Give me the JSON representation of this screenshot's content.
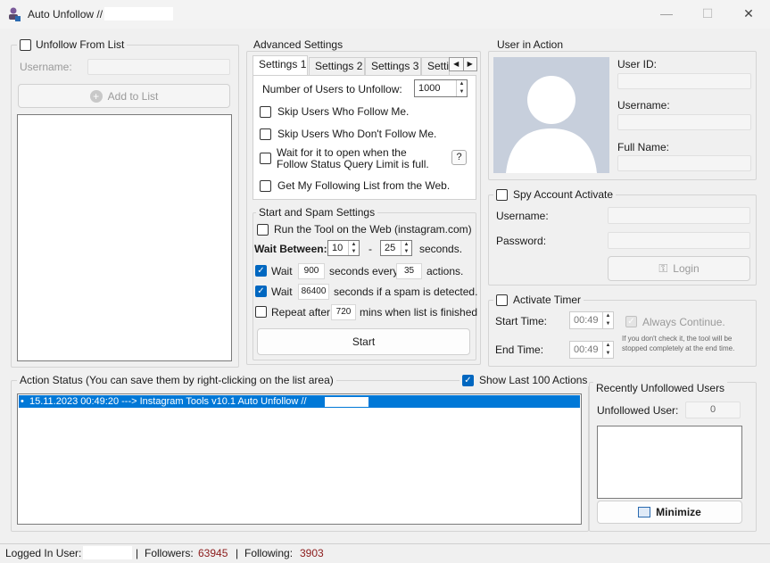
{
  "window": {
    "title": "Auto Unfollow //",
    "close_glyph": "✕",
    "maximize_glyph": "☐",
    "minimize_glyph": "—"
  },
  "left": {
    "checkbox_label": "Unfollow From List",
    "username_label": "Username:",
    "add_button": "Add to List"
  },
  "advanced": {
    "title": "Advanced Settings",
    "tabs": [
      "Settings 1",
      "Settings 2",
      "Settings 3",
      "Setti"
    ],
    "num_users_label": "Number of Users to Unfollow:",
    "num_users_value": "1000",
    "skip_follow": "Skip Users Who Follow Me.",
    "skip_not_follow": "Skip Users Who Don't Follow Me.",
    "wait_open_line1": "Wait for it to open when the",
    "wait_open_line2": "Follow Status Query Limit is full.",
    "help": "?",
    "get_following": "Get My Following List from the Web."
  },
  "spam": {
    "title": "Start and Spam Settings",
    "run_web": "Run the Tool on the Web (instagram.com)",
    "wait_between": "Wait Between:",
    "wait_min": "10",
    "dash": "-",
    "wait_max": "25",
    "seconds": "seconds.",
    "wait1_label": "Wait",
    "wait1_value": "900",
    "every_label": "seconds every",
    "every_value": "35",
    "actions_label": "actions.",
    "wait2_label": "Wait",
    "wait2_value": "86400",
    "spam_label": "seconds if a spam is detected.",
    "repeat_label": "Repeat after",
    "repeat_value": "720",
    "repeat_suffix": "mins when list is finished",
    "start": "Start"
  },
  "user_in_action": {
    "title": "User in Action",
    "user_id": "User ID:",
    "username": "Username:",
    "full_name": "Full Name:"
  },
  "spy": {
    "checkbox_label": "Spy Account Activate",
    "username": "Username:",
    "password": "Password:",
    "login": "Login"
  },
  "timer": {
    "checkbox_label": "Activate Timer",
    "start_time": "Start Time:",
    "start_value": "00:49",
    "end_time": "End Time:",
    "end_value": "00:49",
    "always_continue": "Always Continue.",
    "note_line1": "If you don't check it, the tool will be",
    "note_line2": "stopped completely at the end time."
  },
  "action_status": {
    "title": "Action Status (You can save them by right-clicking on the list area)",
    "show_last": "Show Last 100 Actions",
    "entry": "15.11.2023 00:49:20 ---> Instagram Tools v10.1 Auto Unfollow // "
  },
  "recent": {
    "title": "Recently Unfollowed Users",
    "unfollowed_label": "Unfollowed User:",
    "unfollowed_value": "0",
    "minimize": "Minimize"
  },
  "status_bar": {
    "logged_in": "Logged In User:",
    "sep": "|",
    "followers_label": "Followers:",
    "followers": "63945",
    "following_label": "Following:",
    "following": "3903"
  },
  "colors": {
    "accent": "#0067c0",
    "selection": "#0078d7",
    "stat_red": "#8b1a1a"
  }
}
